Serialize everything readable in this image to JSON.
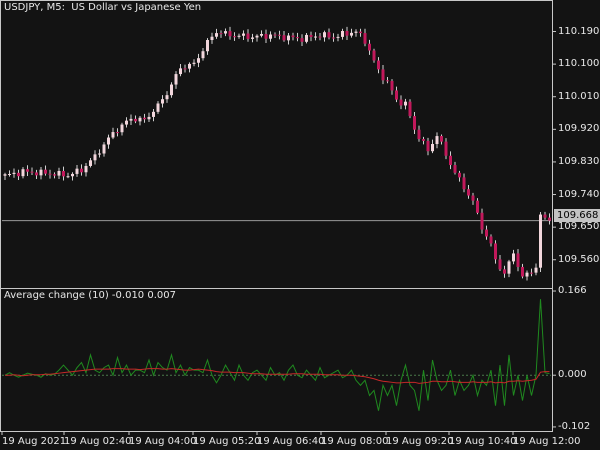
{
  "window": {
    "symbol_title": "USDJPY, M5:  US Dollar vs Japanese Yen",
    "indicator_title": "Average change (10) -0.010 0.007",
    "current_price": "109.668"
  },
  "colors": {
    "background": "#131313",
    "bull_candle": "#f2d6dc",
    "bear_candle": "#c2185b",
    "wick": "#d0d0d0",
    "grid_line": "#c8c8c8",
    "price_line": "#9a9a9a",
    "indicator_fast": "#1f8a1f",
    "indicator_slow": "#c62828",
    "zero_line": "#4a7a4a"
  },
  "chart_data": [
    {
      "type": "candlestick",
      "title": "USDJPY, M5:  US Dollar vs Japanese Yen",
      "y_ticks": [
        "110.190",
        "110.100",
        "110.010",
        "109.920",
        "109.830",
        "109.740",
        "109.650",
        "109.560"
      ],
      "y_tick_values": [
        110.19,
        110.1,
        110.01,
        109.92,
        109.83,
        109.74,
        109.65,
        109.56
      ],
      "ylim": [
        109.482,
        110.277
      ],
      "current_price": 109.668,
      "x_ticks": [
        "19 Aug 2021",
        "19 Aug 02:40",
        "19 Aug 04:00",
        "19 Aug 05:20",
        "19 Aug 06:40",
        "19 Aug 08:00",
        "19 Aug 09:20",
        "19 Aug 10:40",
        "19 Aug 12:00"
      ],
      "close_path": [
        [
          0,
          109.792
        ],
        [
          4,
          109.803
        ],
        [
          10,
          109.798
        ],
        [
          14,
          109.793
        ],
        [
          17,
          109.808
        ],
        [
          20,
          109.845
        ],
        [
          24,
          109.91
        ],
        [
          28,
          109.95
        ],
        [
          31,
          109.945
        ],
        [
          34,
          109.985
        ],
        [
          36,
          110.02
        ],
        [
          39,
          110.09
        ],
        [
          42,
          110.1
        ],
        [
          45,
          110.16
        ],
        [
          47,
          110.19
        ],
        [
          50,
          110.18
        ],
        [
          55,
          110.175
        ],
        [
          59,
          110.18
        ],
        [
          62,
          110.175
        ],
        [
          66,
          110.17
        ],
        [
          70,
          110.18
        ],
        [
          73,
          110.175
        ],
        [
          76,
          110.185
        ],
        [
          78,
          110.19
        ],
        [
          80,
          110.165
        ],
        [
          83,
          110.08
        ],
        [
          85,
          110.05
        ],
        [
          87,
          110.0
        ],
        [
          89,
          109.99
        ],
        [
          91,
          109.92
        ],
        [
          94,
          109.86
        ],
        [
          96,
          109.905
        ],
        [
          98,
          109.85
        ],
        [
          100,
          109.8
        ],
        [
          102,
          109.76
        ],
        [
          104,
          109.72
        ],
        [
          106,
          109.65
        ],
        [
          108,
          109.6
        ],
        [
          109,
          109.56
        ],
        [
          111,
          109.52
        ],
        [
          113,
          109.58
        ],
        [
          115,
          109.51
        ],
        [
          117,
          109.53
        ],
        [
          118,
          109.54
        ],
        [
          119,
          109.68
        ],
        [
          121,
          109.668
        ]
      ]
    },
    {
      "type": "line",
      "title": "Average change (10) -0.010 0.007",
      "y_ticks": [
        "0.166",
        "0.000",
        "-0.102"
      ],
      "y_tick_values": [
        0.166,
        0.0,
        -0.102
      ],
      "ylim": [
        -0.11,
        0.17
      ],
      "series": [
        {
          "color": "#1f8a1f",
          "values": [
            0,
            0.005,
            0,
            -0.004,
            0,
            0.004,
            0.002,
            0,
            -0.004,
            0.003,
            0,
            0.002,
            0.01,
            0.02,
            0.01,
            0.0,
            0.015,
            0.025,
            0.005,
            0.04,
            0.01,
            0.005,
            0.015,
            0.02,
            0.0,
            0.035,
            0.005,
            0.02,
            0.0,
            0.01,
            0.01,
            0.005,
            0.03,
            0.0,
            0.025,
            0.015,
            0.01,
            0.04,
            0.005,
            0.02,
            0.0,
            0.015,
            0.01,
            0.01,
            0.005,
            0.03,
            0.0,
            -0.015,
            0.0,
            0.02,
            0.005,
            -0.01,
            0.02,
            0.0,
            -0.01,
            0.005,
            0.01,
            0.0,
            -0.01,
            0.015,
            0.0,
            0.005,
            -0.01,
            0.01,
            0.02,
            0.0,
            -0.005,
            0.01,
            0.0,
            -0.01,
            0.015,
            -0.005,
            0.0,
            0.005,
            0.01,
            -0.005,
            0.0,
            0.01,
            -0.01,
            -0.02,
            -0.01,
            -0.04,
            -0.03,
            -0.07,
            -0.02,
            -0.04,
            -0.02,
            -0.06,
            -0.01,
            0.02,
            -0.02,
            -0.03,
            -0.07,
            0.01,
            -0.05,
            0.03,
            -0.01,
            -0.03,
            -0.02,
            0.01,
            -0.04,
            -0.01,
            -0.03,
            -0.02,
            0.0,
            -0.04,
            -0.01,
            -0.02,
            0.01,
            -0.06,
            0.02,
            -0.06,
            0.04,
            -0.04,
            0.0,
            -0.05,
            0.0,
            -0.04,
            0.0,
            0.15,
            0.005,
            0.003
          ]
        },
        {
          "color": "#c62828",
          "values": [
            0,
            0,
            0.001,
            0,
            -0.001,
            0,
            0.001,
            0.001,
            0.001,
            0.002,
            0.002,
            0.003,
            0.004,
            0.005,
            0.006,
            0.007,
            0.008,
            0.009,
            0.01,
            0.011,
            0.012,
            0.012,
            0.012,
            0.012,
            0.013,
            0.013,
            0.013,
            0.012,
            0.012,
            0.012,
            0.011,
            0.012,
            0.013,
            0.013,
            0.013,
            0.012,
            0.012,
            0.013,
            0.012,
            0.011,
            0.01,
            0.01,
            0.011,
            0.012,
            0.011,
            0.01,
            0.009,
            0.007,
            0.006,
            0.006,
            0.006,
            0.005,
            0.005,
            0.005,
            0.004,
            0.003,
            0.003,
            0.003,
            0.002,
            0.002,
            0.002,
            0.002,
            0.002,
            0.002,
            0.003,
            0.003,
            0.003,
            0.002,
            0.002,
            0.002,
            0.002,
            0.001,
            0.001,
            0.001,
            0.001,
            0.0,
            0.0,
            0.0,
            -0.001,
            -0.002,
            -0.003,
            -0.005,
            -0.007,
            -0.01,
            -0.012,
            -0.013,
            -0.014,
            -0.015,
            -0.015,
            -0.014,
            -0.014,
            -0.014,
            -0.016,
            -0.015,
            -0.014,
            -0.012,
            -0.012,
            -0.013,
            -0.013,
            -0.012,
            -0.013,
            -0.014,
            -0.014,
            -0.014,
            -0.013,
            -0.014,
            -0.014,
            -0.014,
            -0.013,
            -0.015,
            -0.014,
            -0.015,
            -0.012,
            -0.012,
            -0.011,
            -0.012,
            -0.011,
            -0.01,
            -0.008,
            0.006,
            0.007,
            0.007
          ]
        }
      ]
    }
  ]
}
